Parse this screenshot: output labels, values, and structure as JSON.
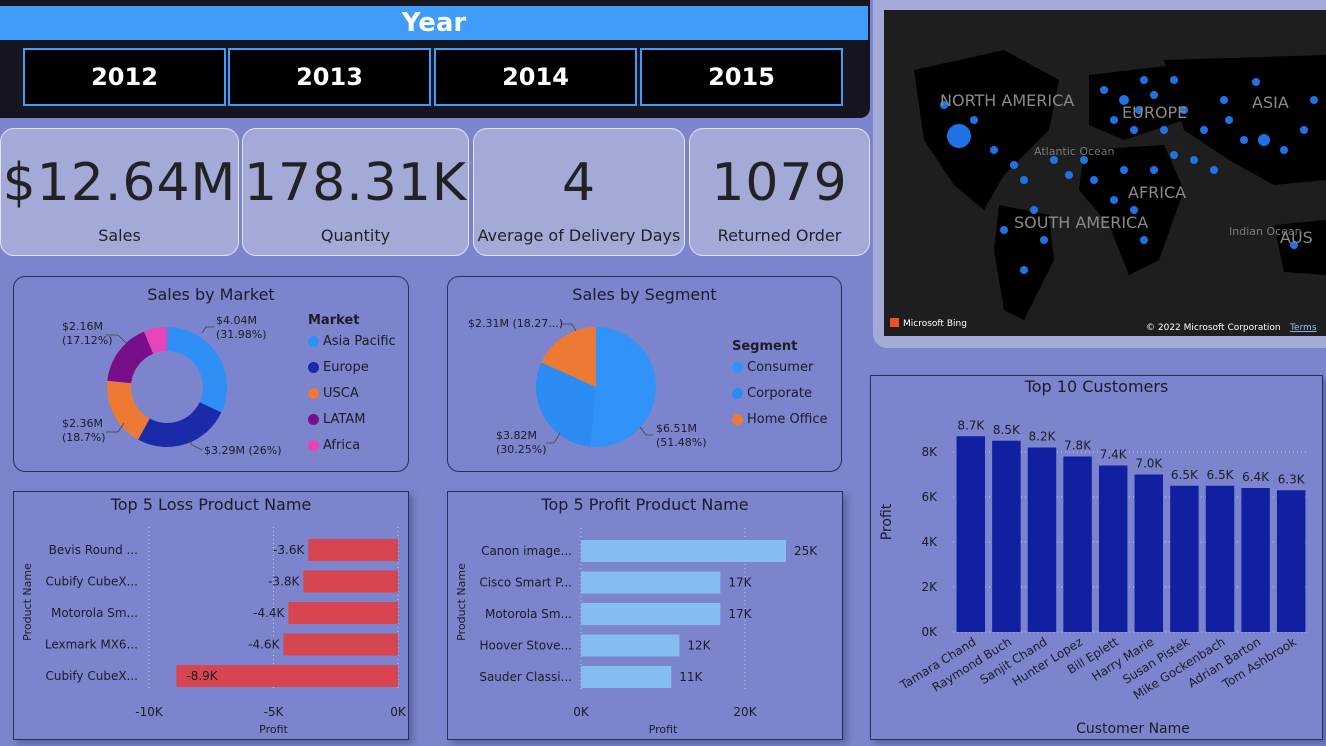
{
  "year_slicer": {
    "title": "Year",
    "years": [
      "2012",
      "2013",
      "2014",
      "2015"
    ]
  },
  "kpis": [
    {
      "value": "$12.64M",
      "label": "Sales"
    },
    {
      "value": "178.31K",
      "label": "Quantity"
    },
    {
      "value": "4",
      "label": "Average of Delivery Days"
    },
    {
      "value": "1079",
      "label": "Returned Order"
    }
  ],
  "map": {
    "labels": [
      "NORTH AMERICA",
      "EUROPE",
      "ASIA",
      "Atlantic Ocean",
      "AFRICA",
      "SOUTH AMERICA",
      "Indian Ocean",
      "AUS"
    ],
    "brand": "Microsoft Bing",
    "copyright": "© 2022 Microsoft Corporation",
    "terms": "Terms"
  },
  "sales_by_market": {
    "title": "Sales by Market",
    "legend_title": "Market",
    "items": [
      {
        "name": "Asia Pacific",
        "value": 4.04,
        "label": "$4.04M",
        "pct": "(31.98%)",
        "color": "#2e8ff5"
      },
      {
        "name": "Europe",
        "value": 3.29,
        "label": "$3.29M (26%)",
        "pct": "",
        "color": "#1b2aa8"
      },
      {
        "name": "USCA",
        "value": 2.36,
        "label": "$2.36M",
        "pct": "(18.7%)",
        "color": "#ec7a35"
      },
      {
        "name": "LATAM",
        "value": 2.16,
        "label": "$2.16M",
        "pct": "(17.12%)",
        "color": "#780f8a"
      },
      {
        "name": "Africa",
        "value": 0.79,
        "label": "",
        "pct": "",
        "color": "#e744b8"
      }
    ]
  },
  "sales_by_segment": {
    "title": "Sales by Segment",
    "legend_title": "Segment",
    "items": [
      {
        "name": "Consumer",
        "value": 6.51,
        "label": "$6.51M",
        "pct": "(51.48%)",
        "color": "#3093f7"
      },
      {
        "name": "Corporate",
        "value": 3.82,
        "label": "$3.82M",
        "pct": "(30.25%)",
        "color": "#2b8cf3"
      },
      {
        "name": "Home Office",
        "value": 2.31,
        "label": "$2.31M (18.27...)",
        "pct": "",
        "color": "#ec7a35"
      }
    ]
  },
  "top_loss": {
    "title": "Top 5 Loss Product Name",
    "ylabel": "Product Name",
    "xlabel": "Profit",
    "xticks": [
      "-10K",
      "-5K",
      "0K"
    ],
    "categories": [
      "Bevis Round ...",
      "Cubify CubeX...",
      "Motorola Sm...",
      "Lexmark MX6...",
      "Cubify CubeX..."
    ],
    "values": [
      -3600,
      -3800,
      -4400,
      -4600,
      -8900
    ],
    "labels": [
      "-3.6K",
      "-3.8K",
      "-4.4K",
      "-4.6K",
      "-8.9K"
    ],
    "color": "#d64550"
  },
  "top_profit": {
    "title": "Top 5 Profit Product Name",
    "ylabel": "Product Name",
    "xlabel": "Profit",
    "xticks": [
      "0K",
      "20K"
    ],
    "categories": [
      "Canon image...",
      "Cisco Smart P...",
      "Motorola Sm...",
      "Hoover Stove...",
      "Sauder Classi..."
    ],
    "values": [
      25000,
      17000,
      17000,
      12000,
      11000
    ],
    "labels": [
      "25K",
      "17K",
      "17K",
      "12K",
      "11K"
    ],
    "color": "#85bdf3"
  },
  "top_customers": {
    "title": "Top 10 Customers",
    "ylabel": "Profit",
    "xlabel": "Customer Name",
    "yticks": [
      "0K",
      "2K",
      "4K",
      "6K",
      "8K"
    ],
    "categories": [
      "Tamara Chand",
      "Raymond Buch",
      "Sanjit Chand",
      "Hunter Lopez",
      "Bill Eplett",
      "Harry Marie",
      "Susan Pistek",
      "Mike Gockenbach",
      "Adrian Barton",
      "Tom Ashbrook"
    ],
    "values": [
      8700,
      8500,
      8200,
      7800,
      7400,
      7000,
      6500,
      6500,
      6400,
      6300
    ],
    "labels": [
      "8.7K",
      "8.5K",
      "8.2K",
      "7.8K",
      "7.4K",
      "7.0K",
      "6.5K",
      "6.5K",
      "6.4K",
      "6.3K"
    ],
    "color": "#1120a0"
  },
  "chart_data": [
    {
      "type": "pie",
      "title": "Sales by Market",
      "categories": [
        "Asia Pacific",
        "Europe",
        "USCA",
        "LATAM",
        "Africa"
      ],
      "values": [
        4.04,
        3.29,
        2.36,
        2.16,
        0.79
      ]
    },
    {
      "type": "pie",
      "title": "Sales by Segment",
      "categories": [
        "Consumer",
        "Corporate",
        "Home Office"
      ],
      "values": [
        6.51,
        3.82,
        2.31
      ]
    },
    {
      "type": "bar",
      "title": "Top 5 Loss Product Name",
      "categories": [
        "Bevis Round ...",
        "Cubify CubeX...",
        "Motorola Sm...",
        "Lexmark MX6...",
        "Cubify CubeX..."
      ],
      "values": [
        -3600,
        -3800,
        -4400,
        -4600,
        -8900
      ],
      "xlabel": "Profit",
      "ylabel": "Product Name",
      "xlim": [
        -10000,
        0
      ]
    },
    {
      "type": "bar",
      "title": "Top 5 Profit Product Name",
      "categories": [
        "Canon image...",
        "Cisco Smart P...",
        "Motorola Sm...",
        "Hoover Stove...",
        "Sauder Classi..."
      ],
      "values": [
        25000,
        17000,
        17000,
        12000,
        11000
      ],
      "xlabel": "Profit",
      "ylabel": "Product Name",
      "xlim": [
        0,
        25000
      ]
    },
    {
      "type": "bar",
      "title": "Top 10 Customers",
      "categories": [
        "Tamara Chand",
        "Raymond Buch",
        "Sanjit Chand",
        "Hunter Lopez",
        "Bill Eplett",
        "Harry Marie",
        "Susan Pistek",
        "Mike Gockenbach",
        "Adrian Barton",
        "Tom Ashbrook"
      ],
      "values": [
        8700,
        8500,
        8200,
        7800,
        7400,
        7000,
        6500,
        6500,
        6400,
        6300
      ],
      "xlabel": "Customer Name",
      "ylabel": "Profit",
      "ylim": [
        0,
        9000
      ]
    }
  ]
}
